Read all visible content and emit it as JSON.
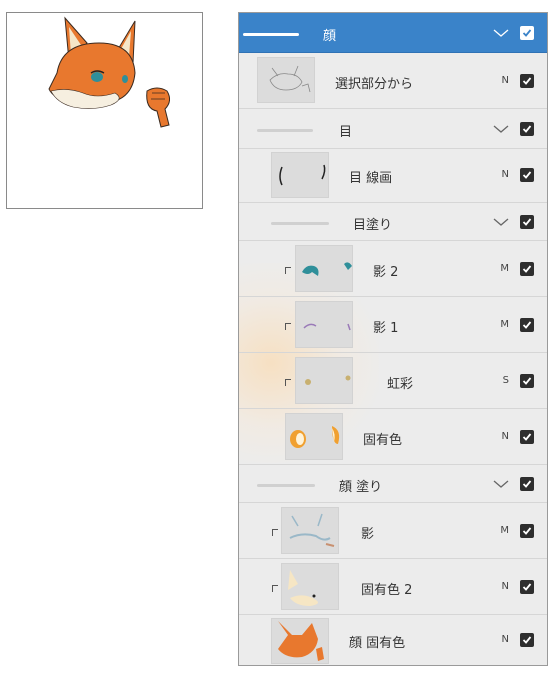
{
  "panel": {
    "layers": [
      {
        "name": "顔",
        "type": "folder",
        "selected": true,
        "visible": true
      },
      {
        "name": "選択部分から",
        "type": "layer",
        "mode": "N",
        "visible": true
      },
      {
        "name": "目",
        "type": "folder",
        "visible": true
      },
      {
        "name": "目 線画",
        "type": "layer",
        "mode": "N",
        "visible": true
      },
      {
        "name": "目塗り",
        "type": "folder",
        "visible": true
      },
      {
        "name": "影 2",
        "type": "layer",
        "mode": "M",
        "clipped": true,
        "visible": true
      },
      {
        "name": "影 1",
        "type": "layer",
        "mode": "M",
        "clipped": true,
        "visible": true
      },
      {
        "name": "虹彩",
        "type": "layer",
        "mode": "S",
        "clipped": true,
        "visible": true
      },
      {
        "name": "固有色",
        "type": "layer",
        "mode": "N",
        "visible": true
      },
      {
        "name": "顔 塗り",
        "type": "folder",
        "visible": true
      },
      {
        "name": "影",
        "type": "layer",
        "mode": "M",
        "clipped": true,
        "visible": true
      },
      {
        "name": "固有色 2",
        "type": "layer",
        "mode": "N",
        "clipped": true,
        "visible": true
      },
      {
        "name": "顔 固有色",
        "type": "layer",
        "mode": "N",
        "visible": true
      }
    ]
  },
  "colors": {
    "selected_row": "#3a83c9",
    "panel_bg": "#ececec",
    "fox_orange": "#e8782e",
    "eye_teal": "#2f8f9a"
  }
}
